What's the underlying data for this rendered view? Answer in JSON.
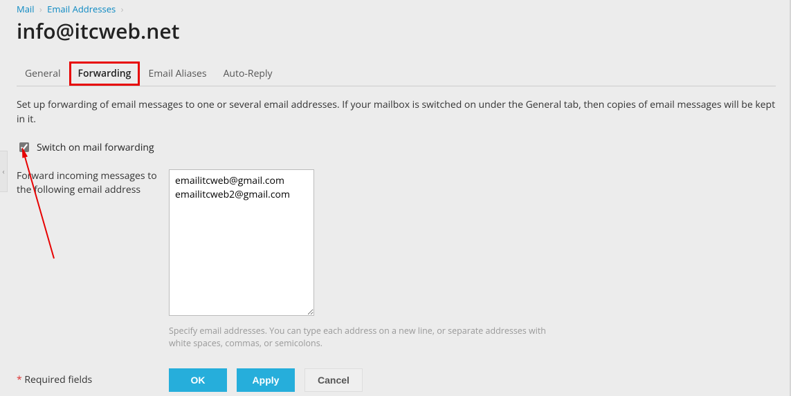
{
  "breadcrumb": {
    "mail": "Mail",
    "email_addresses": "Email Addresses"
  },
  "page_title": "info@itcweb.net",
  "tabs": {
    "general": "General",
    "forwarding": "Forwarding",
    "aliases": "Email Aliases",
    "autoreply": "Auto-Reply"
  },
  "description": "Set up forwarding of email messages to one or several email addresses. If your mailbox is switched on under the General tab, then copies of email messages will be kept in it.",
  "switch_label": "Switch on mail forwarding",
  "forward_label": "Forward incoming messages to the following email address",
  "forward_value": "emailitcweb@gmail.com\nemailitcweb2@gmail.com",
  "helper": "Specify email addresses. You can type each address on a new line, or separate addresses with white spaces, commas, or semicolons.",
  "required": "Required fields",
  "buttons": {
    "ok": "OK",
    "apply": "Apply",
    "cancel": "Cancel"
  },
  "collapse_caret": "‹"
}
